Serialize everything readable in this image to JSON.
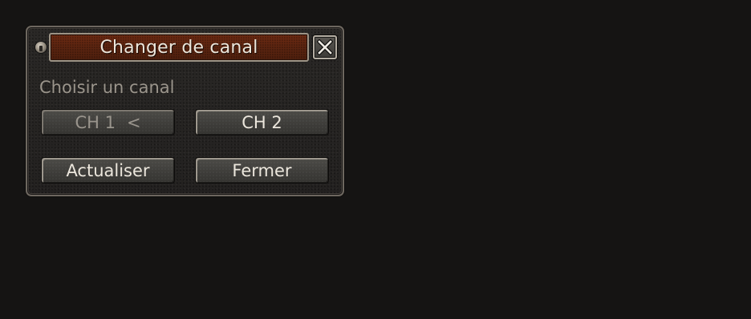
{
  "dialog": {
    "title": "Changer de canal",
    "subtitle": "Choisir un canal",
    "close_icon": "close-icon"
  },
  "channels": [
    {
      "label": "CH 1",
      "marker": "<",
      "state": "current"
    },
    {
      "label": "CH 2",
      "state": "available"
    }
  ],
  "actions": {
    "refresh_label": "Actualiser",
    "close_label": "Fermer"
  },
  "colors": {
    "title_bar": "#5a2410",
    "background": "#151413",
    "button_text": "#ebe6dc",
    "disabled_text": "#99948c"
  }
}
